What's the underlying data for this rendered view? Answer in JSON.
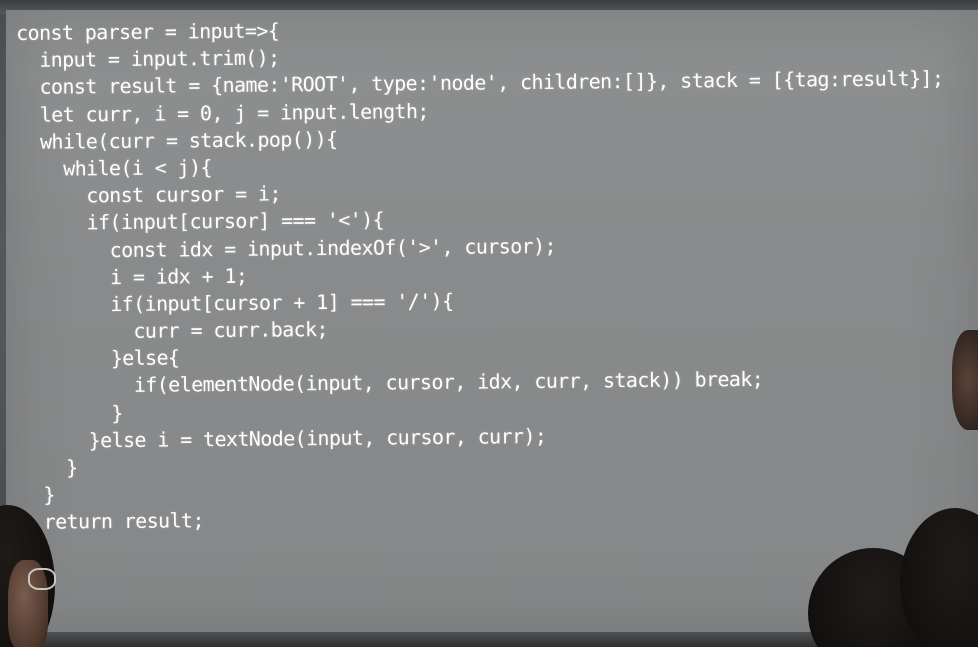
{
  "slide": {
    "code_lines": [
      "const parser = input=>{",
      "  input = input.trim();",
      "  const result = {name:'ROOT', type:'node', children:[]}, stack = [{tag:result}];",
      "  let curr, i = 0, j = input.length;",
      "  while(curr = stack.pop()){",
      "    while(i < j){",
      "      const cursor = i;",
      "      if(input[cursor] === '<'){",
      "        const idx = input.indexOf('>', cursor);",
      "        i = idx + 1;",
      "        if(input[cursor + 1] === '/'){",
      "          curr = curr.back;",
      "        }else{",
      "          if(elementNode(input, cursor, idx, curr, stack)) break;",
      "        }",
      "      }else i = textNode(input, cursor, curr);",
      "    }",
      "  }",
      "  return result;"
    ]
  },
  "colors": {
    "screen": "#888a8b",
    "code_text": "#ffffff",
    "room": "#55585a"
  }
}
